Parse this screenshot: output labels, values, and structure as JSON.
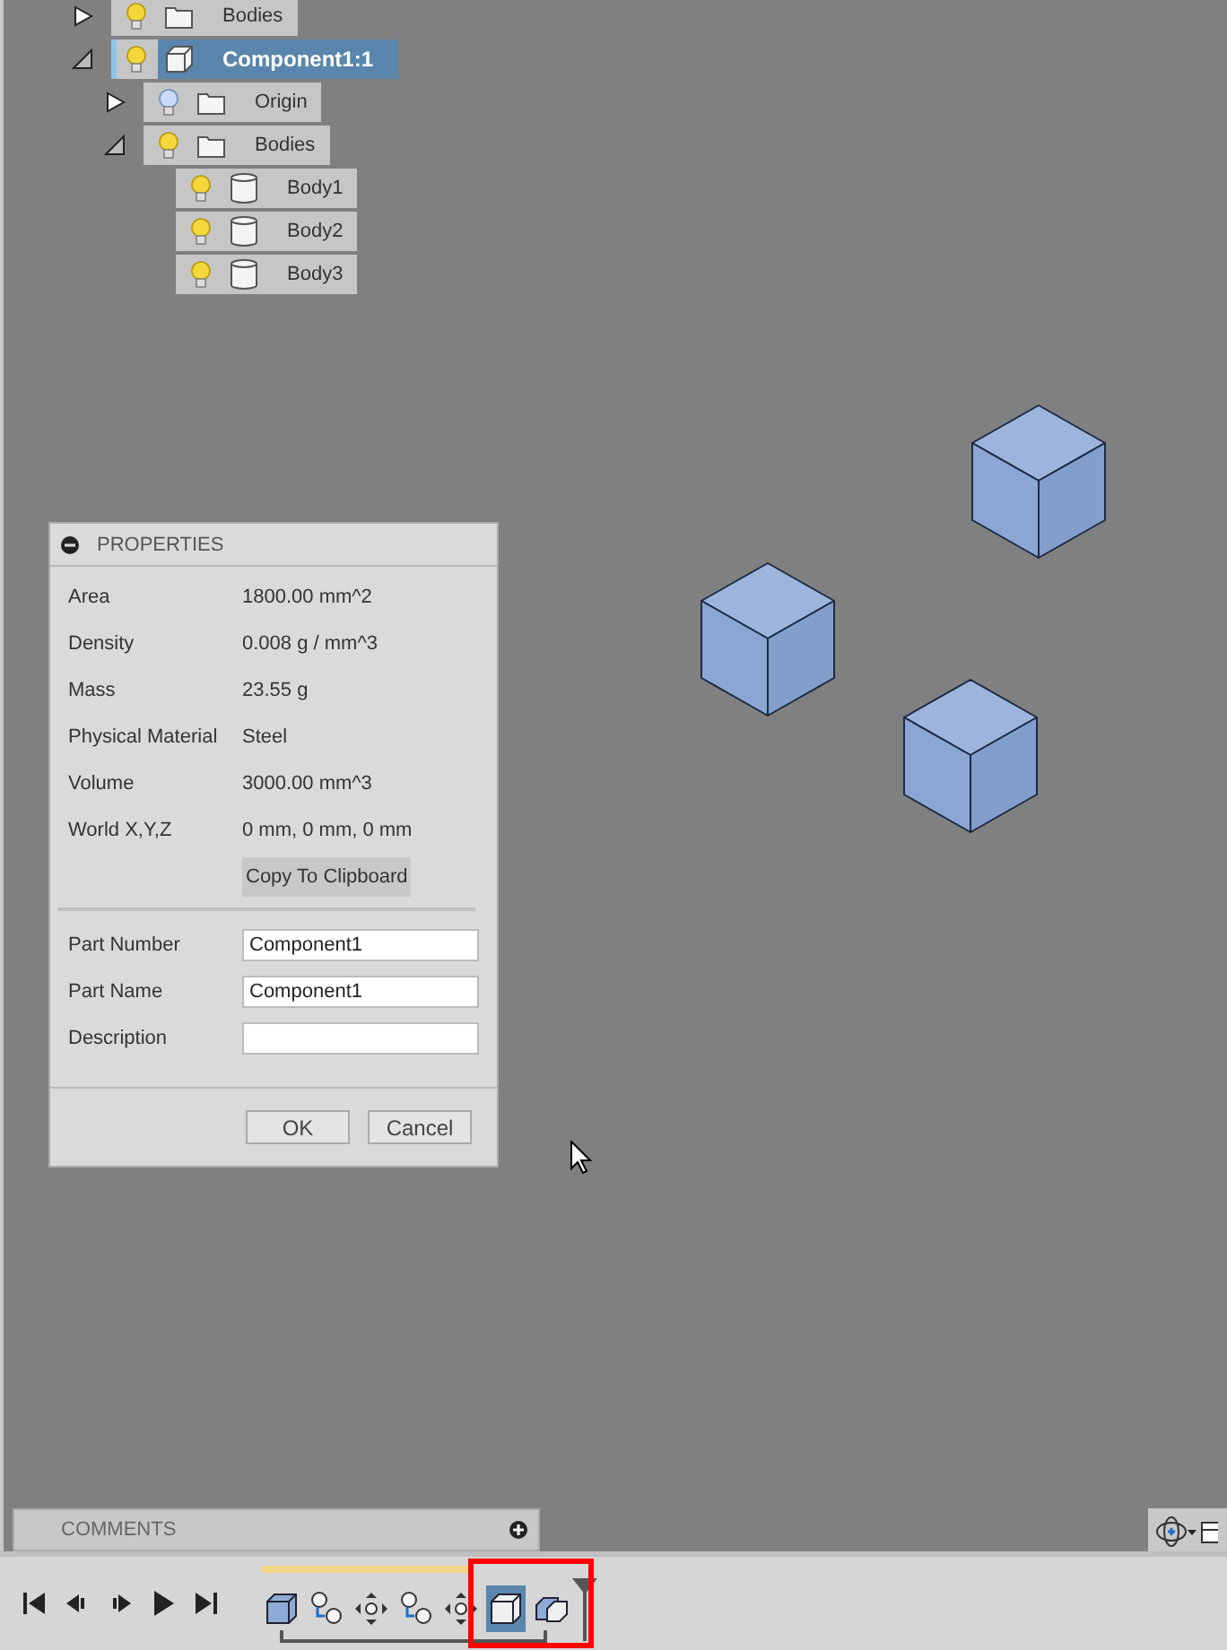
{
  "browser_tree": [
    {
      "label": "Bodies",
      "kind": "folder",
      "expanded": false,
      "visible": true,
      "selected": false
    },
    {
      "label": "Component1:1",
      "kind": "component",
      "expanded": true,
      "visible": true,
      "selected": true,
      "children": [
        {
          "label": "Origin",
          "kind": "folder",
          "expanded": false,
          "visible": false,
          "selected": false
        },
        {
          "label": "Bodies",
          "kind": "folder",
          "expanded": true,
          "visible": true,
          "selected": false,
          "children": [
            {
              "label": "Body1",
              "kind": "body",
              "visible": true,
              "selected": false
            },
            {
              "label": "Body2",
              "kind": "body",
              "visible": true,
              "selected": false
            },
            {
              "label": "Body3",
              "kind": "body",
              "visible": true,
              "selected": false
            }
          ]
        }
      ]
    }
  ],
  "properties": {
    "title": "PROPERTIES",
    "rows": [
      {
        "label": "Area",
        "value": "1800.00 mm^2"
      },
      {
        "label": "Density",
        "value": "0.008 g / mm^3"
      },
      {
        "label": "Mass",
        "value": "23.55 g"
      },
      {
        "label": "Physical Material",
        "value": "Steel"
      },
      {
        "label": "Volume",
        "value": "3000.00 mm^3"
      },
      {
        "label": "World X,Y,Z",
        "value": "0 mm, 0 mm, 0 mm"
      }
    ],
    "copy_button": "Copy To Clipboard",
    "fields": [
      {
        "label": "Part Number",
        "value": "Component1"
      },
      {
        "label": "Part Name",
        "value": "Component1"
      },
      {
        "label": "Description"
      }
    ],
    "buttons": [
      "OK",
      "Cancel"
    ]
  },
  "comments": {
    "title": "COMMENTS"
  },
  "playback": [
    {
      "kind": "first"
    },
    {
      "kind": "prev"
    },
    {
      "kind": "next"
    },
    {
      "kind": "play"
    },
    {
      "kind": "last"
    }
  ],
  "timeline": [
    {
      "kind": "box",
      "selected": false
    },
    {
      "kind": "joint",
      "selected": false
    },
    {
      "kind": "move",
      "selected": false
    },
    {
      "kind": "joint",
      "selected": false
    },
    {
      "kind": "move",
      "selected": false
    },
    {
      "kind": "box",
      "selected": true
    },
    {
      "kind": "combine",
      "selected": false
    }
  ]
}
